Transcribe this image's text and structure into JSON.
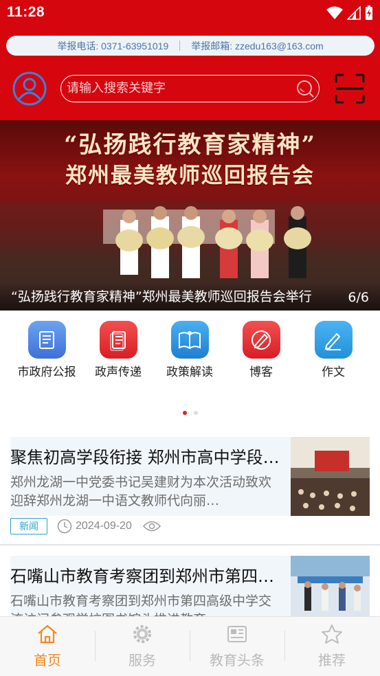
{
  "status_bar": {
    "time": "11:28"
  },
  "hotline": {
    "phone": "举报电话: 0371-63951019",
    "email": "举报邮箱: zzedu163@163.com"
  },
  "search": {
    "placeholder": "请输入搜索关键字"
  },
  "banner": {
    "headline_line1": "“弘扬践行教育家精神”",
    "headline_line2": "郑州最美教师巡回报告会",
    "caption": "“弘扬践行教育家精神”郑州最美教师巡回报告会举行",
    "counter": "6/6"
  },
  "quick_links": [
    {
      "label": "市政府公报",
      "icon": "gazette-icon",
      "color": "#3f7de0"
    },
    {
      "label": "政声传递",
      "icon": "document-icon",
      "color": "#e0242a"
    },
    {
      "label": "政策解读",
      "icon": "open-book-icon",
      "color": "#2a8fd8"
    },
    {
      "label": "博客",
      "icon": "blog-pen-icon",
      "color": "#e0242a"
    },
    {
      "label": "作文",
      "icon": "pencil-icon",
      "color": "#2b9be0"
    }
  ],
  "news": [
    {
      "title": "聚焦初高学段衔接 郑州市高中学段…",
      "desc": "郑州龙湖一中党委书记吴建财为本次活动致欢迎辞郑州龙湖一中语文教师代向丽…",
      "tag": "新闻",
      "date": "2024-09-20"
    },
    {
      "title": "石嘴山市教育考察团到郑州市第四高…",
      "desc": "石嘴山市教育考察团到郑州市第四高级中学交流访问参观学校图书馆头推进教育…"
    }
  ],
  "bottom_nav": [
    {
      "label": "首页",
      "icon": "home-icon",
      "active": true
    },
    {
      "label": "服务",
      "icon": "gear-icon",
      "active": false
    },
    {
      "label": "教育头条",
      "icon": "newspaper-icon",
      "active": false
    },
    {
      "label": "推荐",
      "icon": "star-icon",
      "active": false
    }
  ],
  "colors": {
    "brand_red": "#d6060f",
    "active_orange": "#f08a1c",
    "tag_blue": "#2ba2c8"
  }
}
